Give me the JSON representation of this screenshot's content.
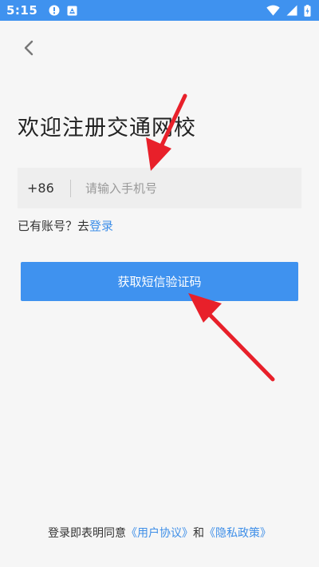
{
  "status_bar": {
    "time": "5:15",
    "icons": [
      "alert-circle-icon",
      "app-badge-icon",
      "wifi-icon",
      "cellular-signal-icon",
      "battery-charging-icon"
    ]
  },
  "header": {
    "back_icon": "chevron-left-icon"
  },
  "main": {
    "title": "欢迎注册交通网校",
    "phone": {
      "country_code": "+86",
      "placeholder": "请输入手机号",
      "value": ""
    },
    "account_prompt": "已有账号？去",
    "login_link": "登录",
    "submit_label": "获取短信验证码"
  },
  "footer": {
    "prefix": "登录即表明同意",
    "user_agreement": "《用户协议》",
    "conjunction": "和",
    "privacy_policy": "《隐私政策》"
  },
  "colors": {
    "primary": "#3f92ef",
    "link": "#3f8fe8",
    "background": "#f6f6f6",
    "annotation": "#e8202a"
  }
}
